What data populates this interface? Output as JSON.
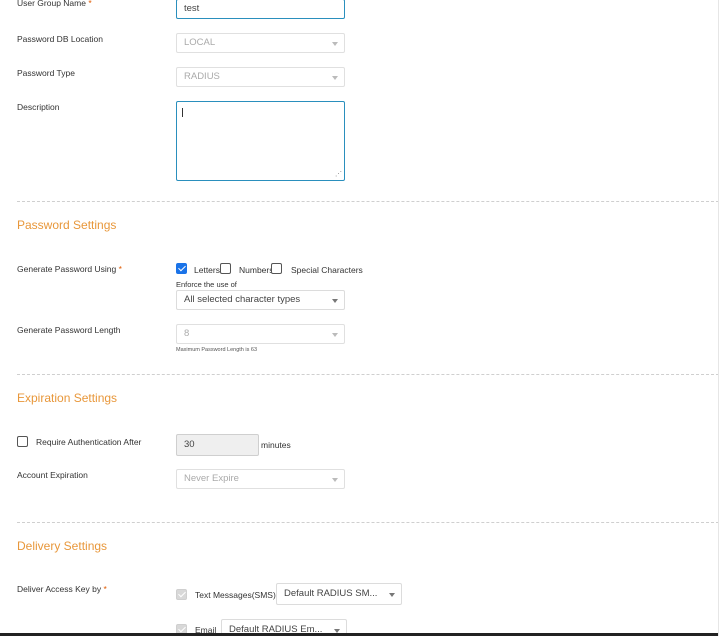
{
  "general": {
    "group_name_label": "User Group Name",
    "required_mark": "*",
    "group_name_value": "test",
    "db_location_label": "Password DB Location",
    "db_location_value": "LOCAL",
    "password_type_label": "Password Type",
    "password_type_value": "RADIUS",
    "description_label": "Description",
    "description_value": ""
  },
  "password_settings": {
    "title": "Password Settings",
    "generate_using_label": "Generate Password Using",
    "letters": {
      "label": "Letters",
      "checked": true
    },
    "numbers": {
      "label": "Numbers",
      "checked": false
    },
    "special": {
      "label": "Special Characters",
      "checked": false
    },
    "enforce_label": "Enforce the use of",
    "enforce_value": "All selected character types",
    "length_label": "Generate Password Length",
    "length_value": "8",
    "length_hint": "Maximum Password Length is 63"
  },
  "expiration_settings": {
    "title": "Expiration Settings",
    "require_auth_label": "Require Authentication After",
    "require_auth_checked": false,
    "require_auth_value": "30",
    "require_auth_unit": "minutes",
    "account_expiration_label": "Account Expiration",
    "account_expiration_value": "Never Expire"
  },
  "delivery_settings": {
    "title": "Delivery Settings",
    "deliver_label": "Deliver Access Key by",
    "sms": {
      "label": "Text Messages(SMS)",
      "checked": true,
      "template": "Default RADIUS SM..."
    },
    "email": {
      "label": "Email",
      "checked": true,
      "template": "Default RADIUS Em..."
    }
  },
  "icons": {
    "dropdown": "chevron-down-icon",
    "resize": "resize-grip-icon"
  },
  "colors": {
    "section_title": "#e8973a",
    "focus_border": "#2a8fbd",
    "checkbox_checked": "#1a73e8",
    "required": "#e05a00"
  }
}
